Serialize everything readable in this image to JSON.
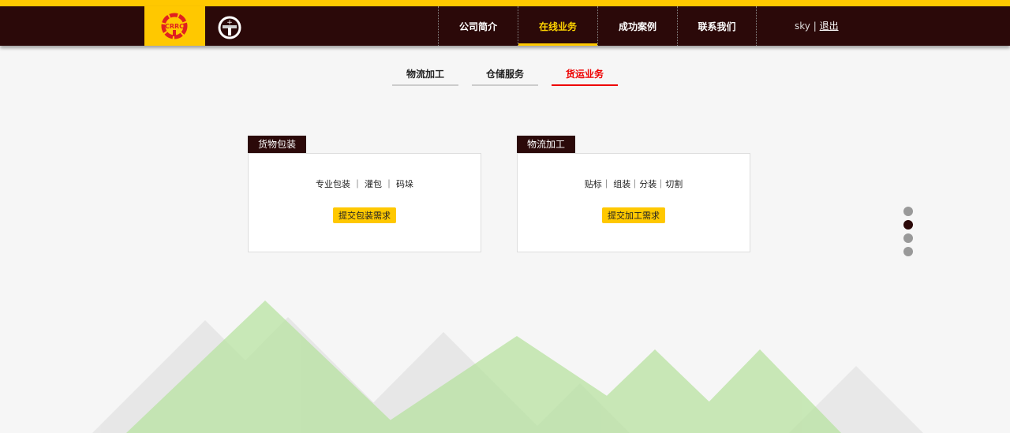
{
  "header": {
    "nav": [
      {
        "label": "公司简介"
      },
      {
        "label": "在线业务",
        "active": true
      },
      {
        "label": "成功案例"
      },
      {
        "label": "联系我们"
      }
    ],
    "user": "sky",
    "separator": "|",
    "logout": "退出"
  },
  "subtabs": [
    {
      "label": "物流加工"
    },
    {
      "label": "仓储服务"
    },
    {
      "label": "货运业务",
      "active": true
    }
  ],
  "cards": [
    {
      "tab": "货物包装",
      "items": "专业包装 ｜ 灌包 ｜ 码垛",
      "button": "提交包装需求"
    },
    {
      "tab": "物流加工",
      "items": "贴标｜ 组装｜分装｜切割",
      "button": "提交加工需求"
    }
  ],
  "logo_text": "CRRC",
  "colors": {
    "brand": "#ffc800",
    "dark": "#2b0909",
    "active": "#e00000"
  }
}
